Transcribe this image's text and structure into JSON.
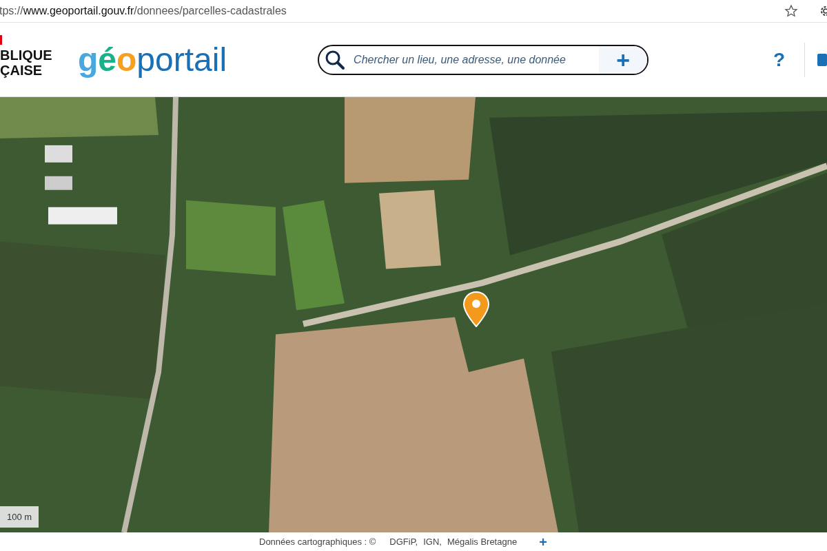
{
  "browser": {
    "url": "tps://**www.geoportail.gouv.fr**/donnees/parcelles-cadastrales"
  },
  "header": {
    "marianne_lines": [
      "BLIQUE",
      "ÇAISE"
    ],
    "logo": [
      {
        "text": "g",
        "color": "#4aa8e0"
      },
      {
        "text": "é",
        "color": "#1bb08c"
      },
      {
        "text": "o",
        "color": "#f5a01f"
      },
      {
        "text": "portail",
        "color": "#1b6fb5"
      }
    ],
    "search": {
      "placeholder": "Chercher un lieu, une adresse, une donnée",
      "add": "+"
    },
    "help": "?"
  },
  "map": {
    "scale": "100 m"
  },
  "footer": {
    "label": "Données cartographiques : ©",
    "sources": [
      "DGFiP,",
      "IGN,",
      "Mégalis Bretagne"
    ],
    "more": "+"
  }
}
